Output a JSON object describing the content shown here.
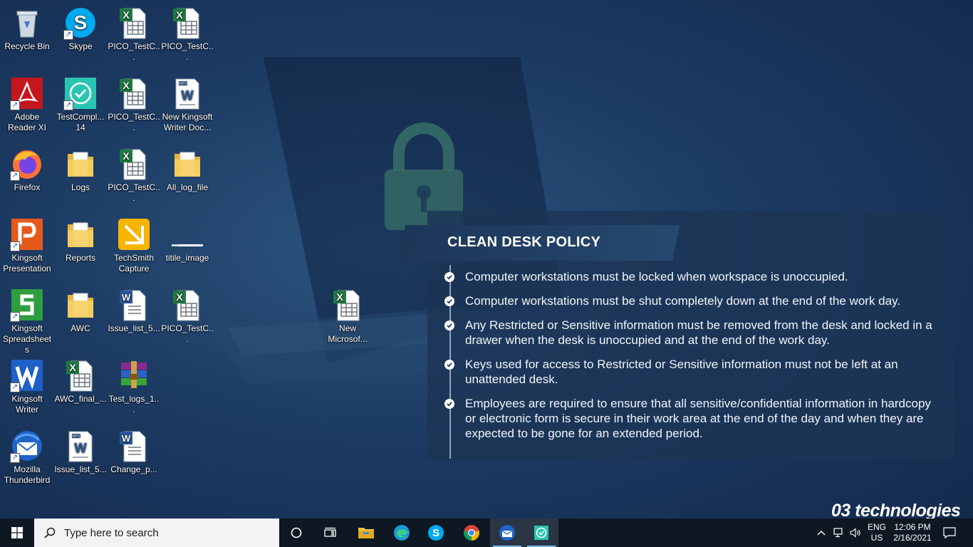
{
  "desktop_icons": [
    {
      "label": "Recycle Bin",
      "icon": "recycle-bin-icon"
    },
    {
      "label": "Skype",
      "icon": "skype-icon"
    },
    {
      "label": "PICO_TestC...",
      "icon": "excel-file-icon"
    },
    {
      "label": "PICO_TestC...",
      "icon": "excel-file-icon"
    },
    {
      "label": "Adobe Reader XI",
      "icon": "adobe-reader-icon"
    },
    {
      "label": "TestCompl... 14",
      "icon": "testcomplete-icon"
    },
    {
      "label": "PICO_TestC...",
      "icon": "excel-file-icon"
    },
    {
      "label": "New Kingsoft Writer Doc...",
      "icon": "wps-doc-icon"
    },
    {
      "label": "Firefox",
      "icon": "firefox-icon"
    },
    {
      "label": "Logs",
      "icon": "folder-icon"
    },
    {
      "label": "PICO_TestC...",
      "icon": "excel-file-icon"
    },
    {
      "label": "All_log_file",
      "icon": "folder-icon"
    },
    {
      "label": "Kingsoft Presentation",
      "icon": "kingsoft-presentation-icon"
    },
    {
      "label": "Reports",
      "icon": "folder-icon"
    },
    {
      "label": "TechSmith Capture",
      "icon": "techsmith-capture-icon"
    },
    {
      "label": "titile_image",
      "icon": "image-file-icon"
    },
    {
      "label": "Kingsoft Spreadsheets",
      "icon": "kingsoft-spreadsheets-icon"
    },
    {
      "label": "AWC",
      "icon": "folder-icon"
    },
    {
      "label": "Issue_list_5...",
      "icon": "word-file-icon"
    },
    {
      "label": "PICO_TestC...",
      "icon": "excel-file-icon"
    },
    {
      "label": "New Microsof...",
      "icon": "excel-file-icon"
    },
    {
      "label": "Kingsoft Writer",
      "icon": "kingsoft-writer-icon"
    },
    {
      "label": "AWC_final_...",
      "icon": "excel-file-icon"
    },
    {
      "label": "Test_logs_1...",
      "icon": "winrar-archive-icon"
    },
    {
      "label": "Mozilla Thunderbird",
      "icon": "thunderbird-icon"
    },
    {
      "label": "Issue_list_5...",
      "icon": "wps-doc-icon"
    },
    {
      "label": "Change_p...",
      "icon": "word-file-icon"
    }
  ],
  "policy": {
    "title": "CLEAN DESK POLICY",
    "items": [
      "Computer workstations must be locked when workspace is unoccupied.",
      "Computer workstations must be shut completely down at the end of the work day.",
      "Any Restricted or Sensitive information must be removed from the desk and locked in a drawer when the desk is unoccupied and at the end of the work day.",
      "Keys used for access to Restricted or Sensitive information must not be left at an unattended desk.",
      "Employees are required to ensure that all sensitive/confidential information in hardcopy or electronic form is secure in their work area at the end of the day and when they are expected to be gone for an extended period."
    ]
  },
  "brand": "03 technologies",
  "taskbar": {
    "search_placeholder": "Type here to search",
    "apps": [
      "cortana-icon",
      "task-view-icon",
      "file-explorer-icon",
      "edge-icon",
      "skype-icon",
      "chrome-icon",
      "thunderbird-icon",
      "testcomplete-icon"
    ],
    "tray": {
      "lang": "ENG",
      "region": "US",
      "time": "12:06 PM",
      "date": "2/16/2021"
    }
  },
  "colors": {
    "taskbar_bg": "#0e1822",
    "desktop_bg": "#1c3a62",
    "panel_bg": "#1c3456",
    "excel_green": "#1f7a43",
    "word_blue": "#2b579a"
  }
}
